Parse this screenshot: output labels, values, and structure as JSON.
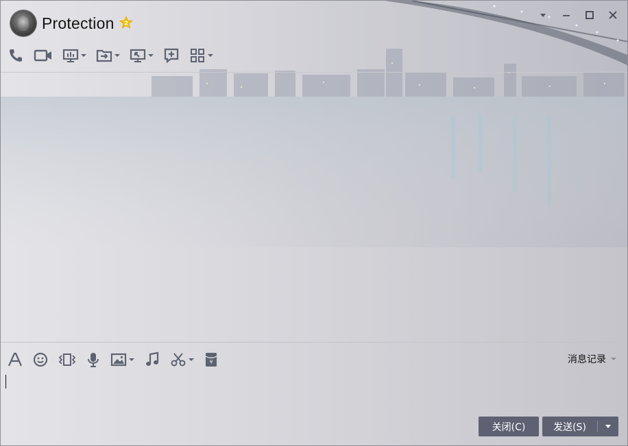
{
  "window": {
    "contact_name": "Protection",
    "controls": [
      "dropdown",
      "minimize",
      "maximize",
      "close"
    ]
  },
  "toolbar": {
    "items": [
      {
        "name": "voice-call",
        "icon": "phone-icon",
        "has_dropdown": false
      },
      {
        "name": "video-call",
        "icon": "video-camera-icon",
        "has_dropdown": false
      },
      {
        "name": "remote-presentation",
        "icon": "presentation-icon",
        "has_dropdown": true
      },
      {
        "name": "send-file",
        "icon": "file-transfer-icon",
        "has_dropdown": true
      },
      {
        "name": "remote-desktop",
        "icon": "remote-desktop-icon",
        "has_dropdown": true
      },
      {
        "name": "create-discussion",
        "icon": "add-chat-icon",
        "has_dropdown": false
      },
      {
        "name": "apps",
        "icon": "apps-grid-icon",
        "has_dropdown": true
      }
    ]
  },
  "input_toolbar": {
    "items": [
      {
        "name": "font",
        "icon": "font-icon",
        "has_dropdown": false
      },
      {
        "name": "emoji",
        "icon": "smiley-icon",
        "has_dropdown": false
      },
      {
        "name": "shake",
        "icon": "shake-window-icon",
        "has_dropdown": false
      },
      {
        "name": "voice-message",
        "icon": "microphone-icon",
        "has_dropdown": false
      },
      {
        "name": "image",
        "icon": "image-icon",
        "has_dropdown": true
      },
      {
        "name": "music",
        "icon": "music-note-icon",
        "has_dropdown": false
      },
      {
        "name": "screenshot",
        "icon": "scissors-icon",
        "has_dropdown": true
      },
      {
        "name": "red-packet",
        "icon": "red-packet-icon",
        "has_dropdown": false
      }
    ],
    "history_label": "消息记录"
  },
  "input": {
    "value": ""
  },
  "buttons": {
    "close_label": "关闭(C)",
    "send_label": "发送(S)"
  },
  "colors": {
    "button_bg": "#5e6172",
    "icon": "#5d6270",
    "vip_star": "#f5c400"
  }
}
